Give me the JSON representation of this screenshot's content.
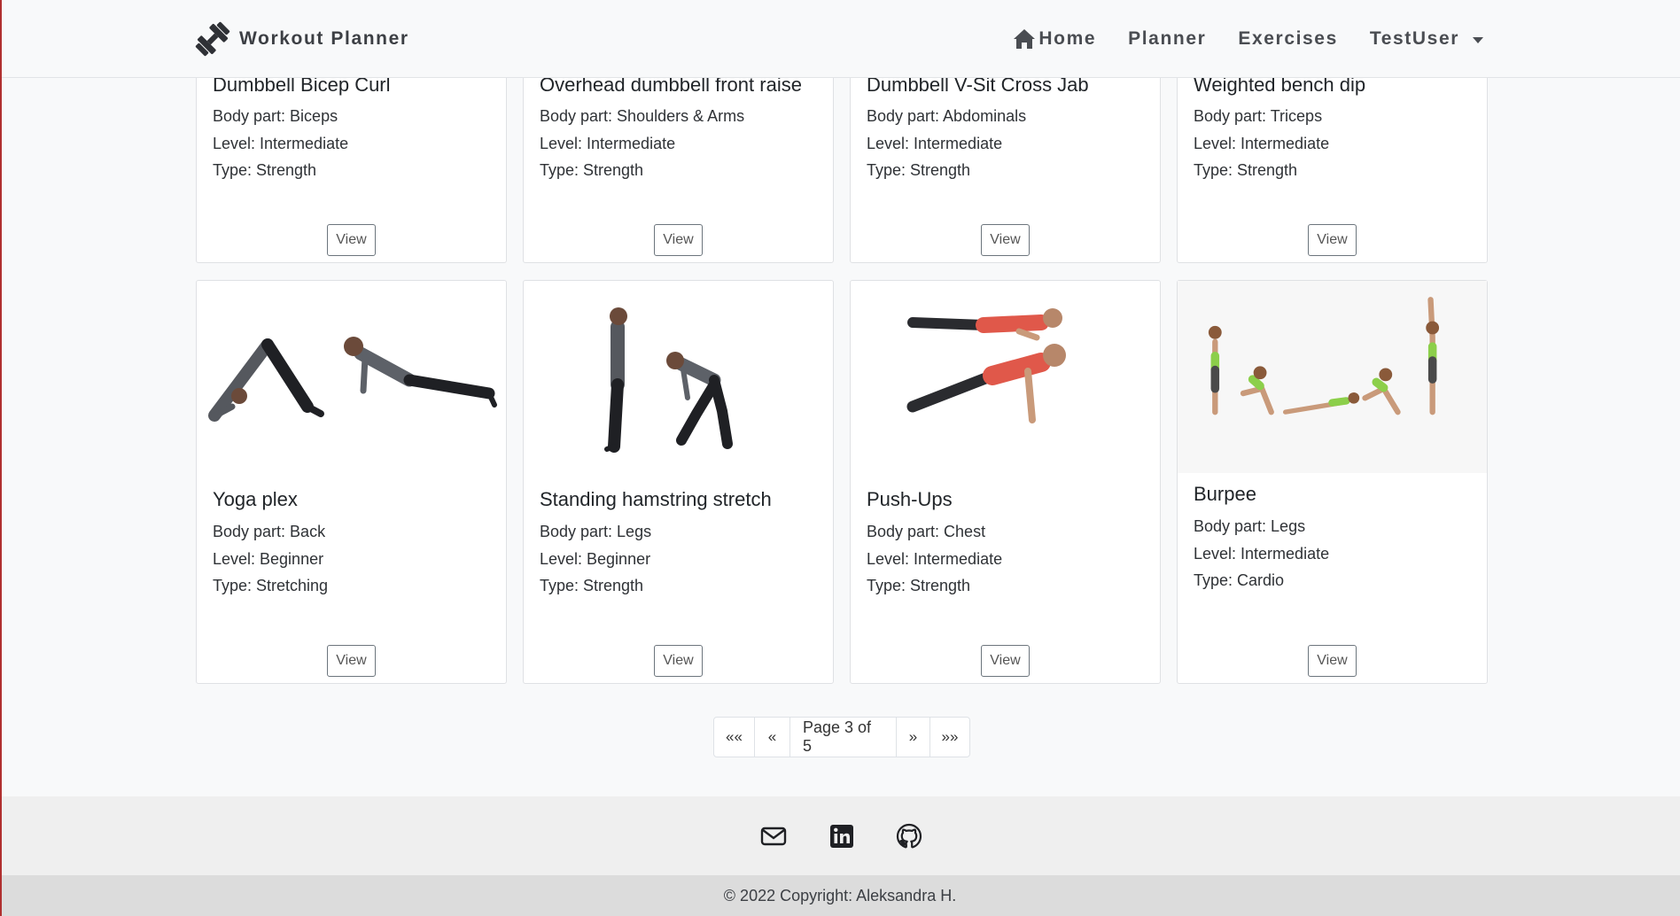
{
  "brand": {
    "title": "Workout Planner",
    "icon": "dumbbell-icon"
  },
  "nav": {
    "home": "Home",
    "planner": "Planner",
    "exercises": "Exercises",
    "user": "TestUser"
  },
  "cards": [
    {
      "title": "Dumbbell Bicep Curl",
      "body_part": "Body part: Biceps",
      "level": "Level: Intermediate",
      "type": "Type: Strength",
      "button": "View"
    },
    {
      "title": "Overhead dumbbell front raise",
      "body_part": "Body part: Shoulders & Arms",
      "level": "Level: Intermediate",
      "type": "Type: Strength",
      "button": "View"
    },
    {
      "title": "Dumbbell V-Sit Cross Jab",
      "body_part": "Body part: Abdominals",
      "level": "Level: Intermediate",
      "type": "Type: Strength",
      "button": "View"
    },
    {
      "title": "Weighted bench dip",
      "body_part": "Body part: Triceps",
      "level": "Level: Intermediate",
      "type": "Type: Strength",
      "button": "View"
    },
    {
      "title": "Yoga plex",
      "body_part": "Body part: Back",
      "level": "Level: Beginner",
      "type": "Type: Stretching",
      "button": "View",
      "image": "yoga-plex-illustration"
    },
    {
      "title": "Standing hamstring stretch",
      "body_part": "Body part: Legs",
      "level": "Level: Beginner",
      "type": "Type: Strength",
      "button": "View",
      "image": "hamstring-stretch-illustration"
    },
    {
      "title": "Push-Ups",
      "body_part": "Body part: Chest",
      "level": "Level: Intermediate",
      "type": "Type: Strength",
      "button": "View",
      "image": "push-ups-illustration"
    },
    {
      "title": "Burpee",
      "body_part": "Body part: Legs",
      "level": "Level: Intermediate",
      "type": "Type: Cardio",
      "button": "View",
      "image": "burpee-illustration"
    }
  ],
  "pagination": {
    "first": "««",
    "prev": "«",
    "label": "Page 3 of 5",
    "next": "»",
    "last": "»»"
  },
  "footer": {
    "icons": [
      "envelope-icon",
      "linkedin-icon",
      "github-icon"
    ],
    "copyright": "© 2022 Copyright: Aleksandra H."
  },
  "colors": {
    "page_bg": "#f8f9fa",
    "footer_icons_bg": "#efefef",
    "footer_bottom_bg": "#dcdcdc",
    "push_ups_shirt": "#e0584a",
    "burpee_top": "#8ccf4a"
  }
}
